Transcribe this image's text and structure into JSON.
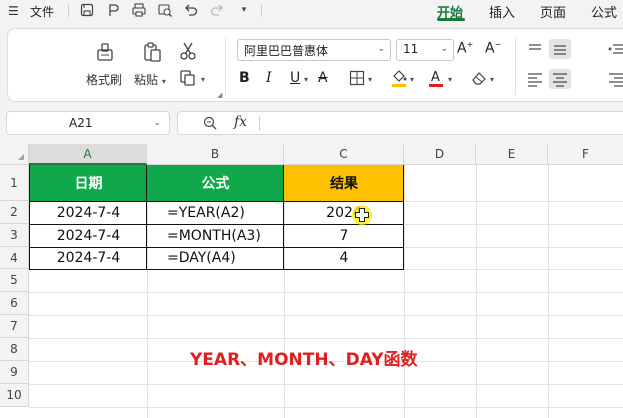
{
  "menubar": {
    "file_label": "文件",
    "tabs": [
      "开始",
      "插入",
      "页面",
      "公式"
    ],
    "active_tab": "开始"
  },
  "ribbon": {
    "format_painter_label": "格式刷",
    "paste_label": "粘贴",
    "font_name": "阿里巴巴普惠体",
    "font_size": "11"
  },
  "formula_bar": {
    "cell_ref": "A21",
    "fx_label": "fx",
    "formula": ""
  },
  "sheet": {
    "columns": [
      "A",
      "B",
      "C",
      "D",
      "E",
      "F"
    ],
    "selected_column": "A",
    "rows": [
      "1",
      "2",
      "3",
      "4",
      "5",
      "6",
      "7",
      "8",
      "9",
      "10"
    ],
    "table": {
      "headers": [
        "日期",
        "公式",
        "结果"
      ],
      "header_colors": [
        "#0fa84a",
        "#0fa84a",
        "#ffc000"
      ],
      "rows": [
        [
          "2024-7-4",
          "=YEAR(A2)",
          "2024"
        ],
        [
          "2024-7-4",
          "=MONTH(A3)",
          "7"
        ],
        [
          "2024-7-4",
          "=DAY(A4)",
          "4"
        ]
      ]
    },
    "caption": "YEAR、MONTH、DAY函数"
  }
}
